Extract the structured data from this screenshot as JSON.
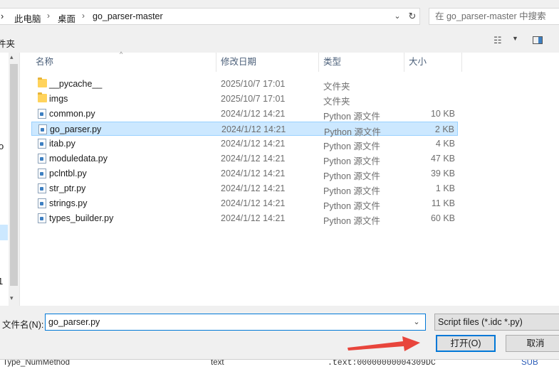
{
  "address": {
    "crumbs": [
      "此电脑",
      "桌面",
      "go_parser-master"
    ],
    "dropdown_icon": "chevron-down-icon",
    "refresh_icon": "refresh-icon"
  },
  "search": {
    "placeholder": "在 go_parser-master 中搜索"
  },
  "toolbar": {
    "left_fragment": "件夹",
    "view_icon": "view-options-icon",
    "pane_icon": "preview-pane-icon"
  },
  "nav": {
    "fragment_o": "o",
    "fragment_1": "1"
  },
  "columns": {
    "name": "名称",
    "date": "修改日期",
    "type": "类型",
    "size": "大小"
  },
  "files": [
    {
      "name": "__pycache__",
      "date": "2025/10/7 17:01",
      "type": "文件夹",
      "size": "",
      "kind": "folder"
    },
    {
      "name": "imgs",
      "date": "2025/10/7 17:01",
      "type": "文件夹",
      "size": "",
      "kind": "folder"
    },
    {
      "name": "common.py",
      "date": "2024/1/12 14:21",
      "type": "Python 源文件",
      "size": "10 KB",
      "kind": "py"
    },
    {
      "name": "go_parser.py",
      "date": "2024/1/12 14:21",
      "type": "Python 源文件",
      "size": "2 KB",
      "kind": "py",
      "selected": true
    },
    {
      "name": "itab.py",
      "date": "2024/1/12 14:21",
      "type": "Python 源文件",
      "size": "4 KB",
      "kind": "py"
    },
    {
      "name": "moduledata.py",
      "date": "2024/1/12 14:21",
      "type": "Python 源文件",
      "size": "47 KB",
      "kind": "py"
    },
    {
      "name": "pclntbl.py",
      "date": "2024/1/12 14:21",
      "type": "Python 源文件",
      "size": "39 KB",
      "kind": "py"
    },
    {
      "name": "str_ptr.py",
      "date": "2024/1/12 14:21",
      "type": "Python 源文件",
      "size": "1 KB",
      "kind": "py"
    },
    {
      "name": "strings.py",
      "date": "2024/1/12 14:21",
      "type": "Python 源文件",
      "size": "11 KB",
      "kind": "py"
    },
    {
      "name": "types_builder.py",
      "date": "2024/1/12 14:21",
      "type": "Python 源文件",
      "size": "60 KB",
      "kind": "py"
    }
  ],
  "filename": {
    "label": "文件名(N):",
    "value": "go_parser.py"
  },
  "filter": {
    "value": "Script files (*.idc *.py)"
  },
  "buttons": {
    "open": "打开(O)",
    "cancel": "取消"
  },
  "background": {
    "left_text": "Type_NumMethod",
    "mid_text": "text",
    "right_text": ".text:00000000004309DC",
    "far_text": "SUB"
  },
  "colors": {
    "accent": "#0078d7",
    "selection": "#cce8ff",
    "arrow": "#e8453c"
  }
}
